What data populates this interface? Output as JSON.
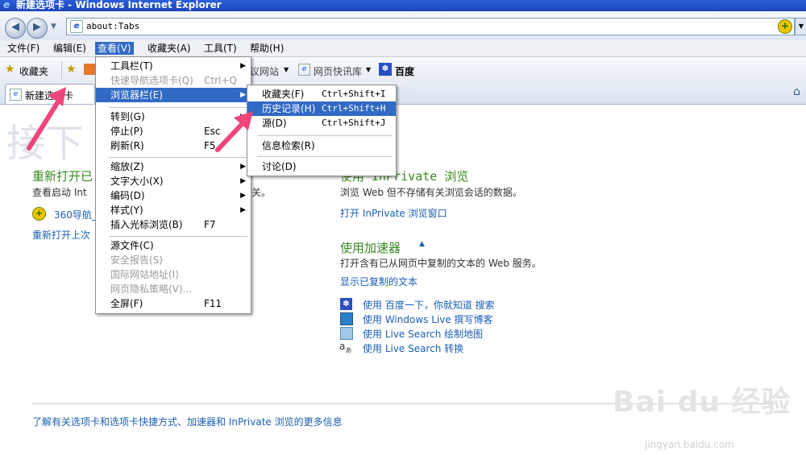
{
  "window": {
    "title": "新建选项卡 - Windows Internet Explorer"
  },
  "address": {
    "url": "about:Tabs"
  },
  "menubar": {
    "items": [
      "文件(F)",
      "编辑(E)",
      "查看(V)",
      "收藏夹(A)",
      "工具(T)",
      "帮助(H)"
    ]
  },
  "favbar": {
    "favorites": "收藏夹",
    "suggested": "议网站",
    "webslice": "网页快讯库",
    "baidu": "百度"
  },
  "tab": {
    "label": "新建选项卡"
  },
  "content": {
    "watermark_big": "接下",
    "reopen_title": "重新打开已",
    "reopen_desc": "查看启动 Int",
    "reopen_desc_tail": "关。",
    "nav360": "360导航_",
    "reopen_last": "重新打开上次",
    "inprivate_title": "使用 InPrivate 浏览",
    "inprivate_desc": "浏览 Web 但不存储有关浏览会话的数据。",
    "inprivate_link": "打开 InPrivate 浏览窗口",
    "accel_title": "使用加速器",
    "accel_desc": "打开含有已从网页中复制的文本的 Web 服务。",
    "accel_link": "显示已复制的文本",
    "accel_items": [
      "使用 百度一下，你就知道 搜索",
      "使用 Windows Live 撰写博客",
      "使用 Live Search 绘制地图",
      "使用 Live Search 转换"
    ],
    "footer_link": "了解有关选项卡和选项卡快捷方式、加速器和 InPrivate 浏览的更多信息"
  },
  "view_menu": [
    {
      "label": "工具栏(T)",
      "accel": "",
      "submenu": true,
      "disabled": false
    },
    {
      "label": "快速导航选项卡(Q)",
      "accel": "Ctrl+Q",
      "submenu": false,
      "disabled": true
    },
    {
      "label": "浏览器栏(E)",
      "accel": "",
      "submenu": true,
      "disabled": false,
      "selected": true
    },
    {
      "label": "转到(G)",
      "accel": "",
      "submenu": true,
      "disabled": false
    },
    {
      "label": "停止(P)",
      "accel": "Esc",
      "submenu": false,
      "disabled": false
    },
    {
      "label": "刷新(R)",
      "accel": "F5",
      "submenu": false,
      "disabled": false
    },
    {
      "label": "缩放(Z)",
      "accel": "",
      "submenu": true,
      "disabled": false
    },
    {
      "label": "文字大小(X)",
      "accel": "",
      "submenu": true,
      "disabled": false
    },
    {
      "label": "编码(D)",
      "accel": "",
      "submenu": true,
      "disabled": false
    },
    {
      "label": "样式(Y)",
      "accel": "",
      "submenu": true,
      "disabled": false
    },
    {
      "label": "插入光标浏览(B)",
      "accel": "F7",
      "submenu": false,
      "disabled": false
    },
    {
      "label": "源文件(C)",
      "accel": "",
      "submenu": false,
      "disabled": false
    },
    {
      "label": "安全报告(S)",
      "accel": "",
      "submenu": false,
      "disabled": true
    },
    {
      "label": "国际网站地址(I)",
      "accel": "",
      "submenu": false,
      "disabled": true
    },
    {
      "label": "网页隐私策略(V)...",
      "accel": "",
      "submenu": false,
      "disabled": true
    },
    {
      "label": "全屏(F)",
      "accel": "F11",
      "submenu": false,
      "disabled": false
    }
  ],
  "browser_bar_menu": [
    {
      "label": "收藏夹(F)",
      "accel": "Ctrl+Shift+I"
    },
    {
      "label": "历史记录(H)",
      "accel": "Ctrl+Shift+H",
      "selected": true
    },
    {
      "label": "源(D)",
      "accel": "Ctrl+Shift+J"
    },
    {
      "label": "信息检索(R)",
      "accel": ""
    },
    {
      "label": "讨论(D)",
      "accel": ""
    }
  ],
  "colors": {
    "accent": "#316ac5",
    "annotation": "#f0457a",
    "heading": "#3a8a23",
    "link": "#1a5fb4"
  },
  "watermark": {
    "brand": "Bai du 经验",
    "url": "jingyan.baidu.com"
  }
}
